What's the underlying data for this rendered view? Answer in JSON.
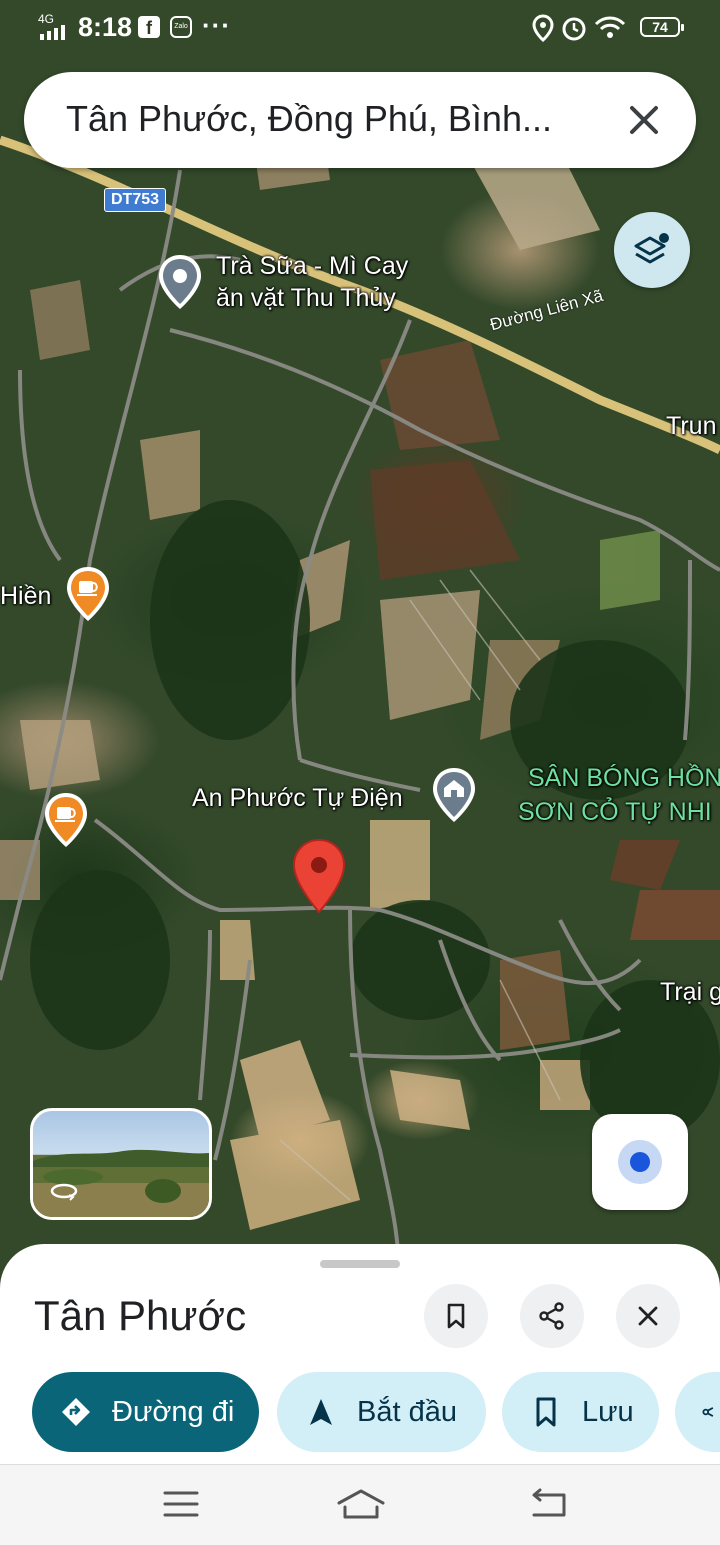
{
  "status_bar": {
    "network": "4G",
    "time": "8:18",
    "zalo_label": "Zalo",
    "more": "···",
    "battery": "74"
  },
  "search": {
    "query": "Tân Phước, Đồng Phú, Bình...",
    "clear_icon": "close-icon"
  },
  "map": {
    "road_shield": "DT753",
    "road_name": "Đường Liên Xã",
    "labels": {
      "poi_milk_tea_line1": "Trà Sữa - Mì Cay",
      "poi_milk_tea_line2": "ăn vặt Thu Thủy",
      "trun": "Trun",
      "hien": "Hiền",
      "an_phuoc": "An Phước Tự Điện",
      "san_bong_line1": "SÂN BÓNG HỒN",
      "san_bong_line2": "SƠN CỎ TỰ NHI",
      "trai": "Trại g"
    },
    "colors": {
      "pin_red": "#ea4335",
      "poi_orange": "#f08a24",
      "poi_gray": "#6b7c8c",
      "green_label": "#6ee0a0"
    }
  },
  "place": {
    "title": "Tân Phước",
    "actions": {
      "directions": "Đường đi",
      "start": "Bắt đầu",
      "save": "Lưu"
    }
  }
}
